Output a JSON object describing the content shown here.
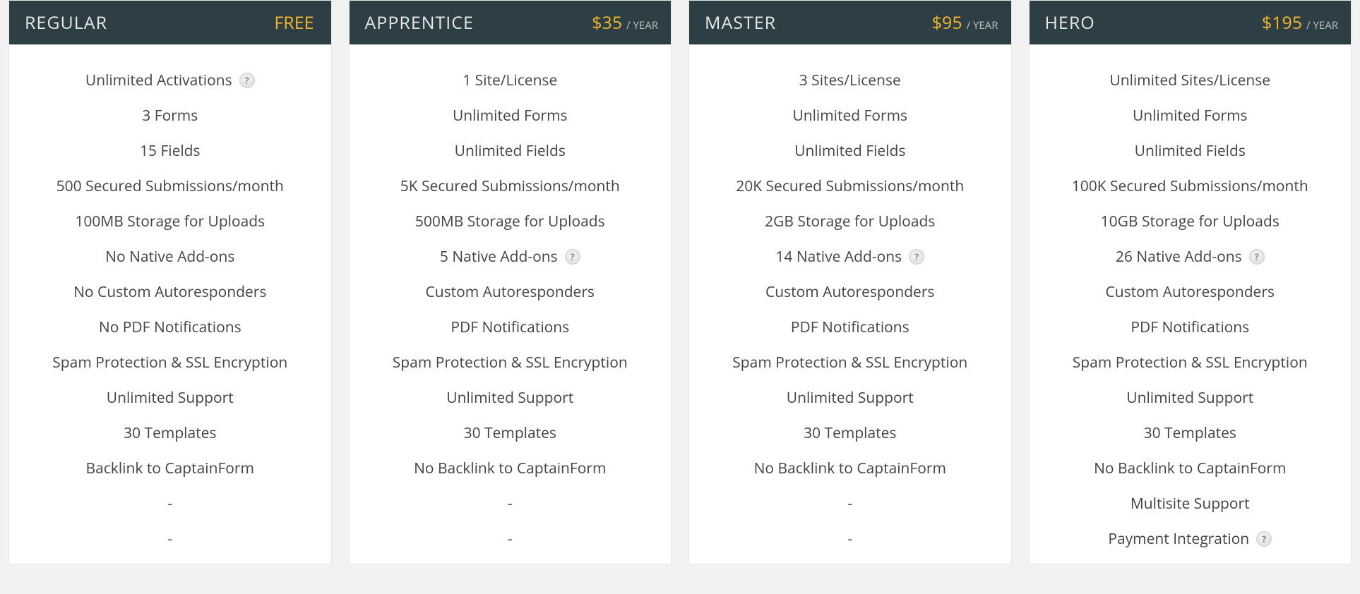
{
  "help_symbol": "?",
  "plans": [
    {
      "name": "REGULAR",
      "price": "FREE",
      "period": "",
      "features": [
        {
          "text": "Unlimited Activations",
          "help": true
        },
        {
          "text": "3 Forms"
        },
        {
          "text": "15 Fields"
        },
        {
          "text": "500 Secured Submissions/month"
        },
        {
          "text": "100MB Storage for Uploads"
        },
        {
          "text": "No Native Add-ons"
        },
        {
          "text": "No Custom Autoresponders"
        },
        {
          "text": "No PDF Notifications"
        },
        {
          "text": "Spam Protection & SSL Encryption"
        },
        {
          "text": "Unlimited Support"
        },
        {
          "text": "30 Templates"
        },
        {
          "text": "Backlink to CaptainForm"
        },
        {
          "text": "-"
        },
        {
          "text": "-"
        }
      ]
    },
    {
      "name": "APPRENTICE",
      "price": "$35",
      "period": "/ YEAR",
      "features": [
        {
          "text": "1 Site/License"
        },
        {
          "text": "Unlimited Forms"
        },
        {
          "text": "Unlimited Fields"
        },
        {
          "text": "5K Secured Submissions/month"
        },
        {
          "text": "500MB Storage for Uploads"
        },
        {
          "text": "5 Native Add-ons",
          "help": true
        },
        {
          "text": "Custom Autoresponders"
        },
        {
          "text": "PDF Notifications"
        },
        {
          "text": "Spam Protection & SSL Encryption"
        },
        {
          "text": "Unlimited Support"
        },
        {
          "text": "30 Templates"
        },
        {
          "text": "No Backlink to CaptainForm"
        },
        {
          "text": "-"
        },
        {
          "text": "-"
        }
      ]
    },
    {
      "name": "MASTER",
      "price": "$95",
      "period": "/ YEAR",
      "features": [
        {
          "text": "3 Sites/License"
        },
        {
          "text": "Unlimited Forms"
        },
        {
          "text": "Unlimited Fields"
        },
        {
          "text": "20K Secured Submissions/month"
        },
        {
          "text": "2GB Storage for Uploads"
        },
        {
          "text": "14 Native Add-ons",
          "help": true
        },
        {
          "text": "Custom Autoresponders"
        },
        {
          "text": "PDF Notifications"
        },
        {
          "text": "Spam Protection & SSL Encryption"
        },
        {
          "text": "Unlimited Support"
        },
        {
          "text": "30 Templates"
        },
        {
          "text": "No Backlink to CaptainForm"
        },
        {
          "text": "-"
        },
        {
          "text": "-"
        }
      ]
    },
    {
      "name": "HERO",
      "price": "$195",
      "period": "/ YEAR",
      "features": [
        {
          "text": "Unlimited Sites/License"
        },
        {
          "text": "Unlimited Forms"
        },
        {
          "text": "Unlimited Fields"
        },
        {
          "text": "100K Secured Submissions/month"
        },
        {
          "text": "10GB Storage for Uploads"
        },
        {
          "text": "26 Native Add-ons",
          "help": true
        },
        {
          "text": "Custom Autoresponders"
        },
        {
          "text": "PDF Notifications"
        },
        {
          "text": "Spam Protection & SSL Encryption"
        },
        {
          "text": "Unlimited Support"
        },
        {
          "text": "30 Templates"
        },
        {
          "text": "No Backlink to CaptainForm"
        },
        {
          "text": "Multisite Support"
        },
        {
          "text": "Payment Integration",
          "help": true
        }
      ]
    }
  ]
}
